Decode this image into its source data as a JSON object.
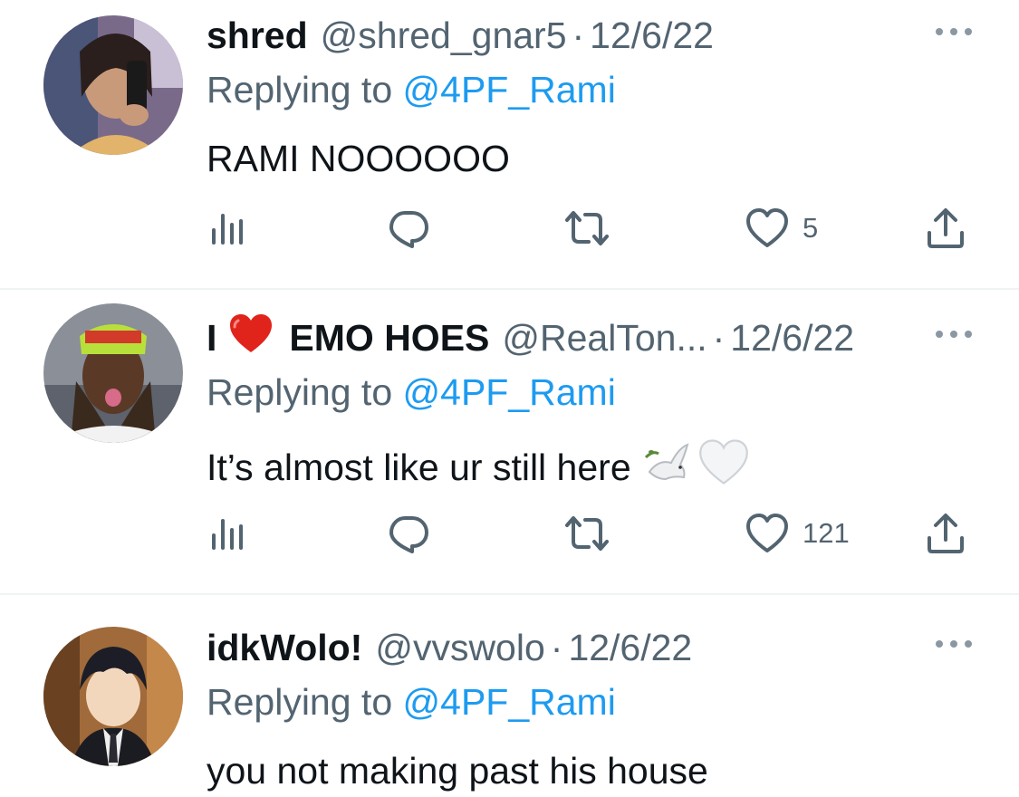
{
  "tweets": [
    {
      "display_name": "shred",
      "handle": "@shred_gnar5",
      "separator": "·",
      "date": "12/6/22",
      "replying_prefix": "Replying to ",
      "replying_to": "@4PF_Rami",
      "text": "RAMI NOOOOOO",
      "likes": "5"
    },
    {
      "display_name": "I",
      "display_name_suffix": "EMO HOES",
      "handle": "@RealTon...",
      "separator": "·",
      "date": "12/6/22",
      "replying_prefix": "Replying to ",
      "replying_to": "@4PF_Rami",
      "text": "It’s almost like ur still here",
      "likes": "121"
    },
    {
      "display_name": "idkWolo!",
      "handle": "@vvswolo",
      "separator": "·",
      "date": "12/6/22",
      "replying_prefix": "Replying to ",
      "replying_to": "@4PF_Rami",
      "text": "you not making past his house"
    }
  ],
  "icons": {
    "views": "views-icon",
    "reply": "reply-icon",
    "retweet": "retweet-icon",
    "like": "heart-icon",
    "share": "share-icon",
    "more": "more-icon"
  },
  "colors": {
    "text": "#0f1419",
    "secondary": "#536471",
    "link": "#1d9bf0",
    "divider": "#eff3f4"
  }
}
